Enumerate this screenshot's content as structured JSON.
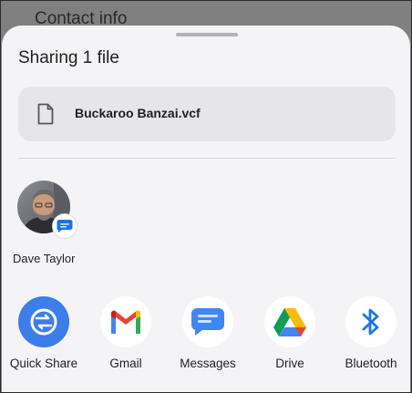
{
  "background": {
    "text": "Contact info"
  },
  "sheet": {
    "title": "Sharing 1 file",
    "file": {
      "name": "Buckaroo Banzai.vcf",
      "icon": "document-icon"
    }
  },
  "contacts": [
    {
      "name": "Dave Taylor",
      "badge_icon": "messages-icon"
    }
  ],
  "apps": [
    {
      "label": "Quick Share",
      "icon": "quick-share-icon",
      "color": "#3b7de9"
    },
    {
      "label": "Gmail",
      "icon": "gmail-icon"
    },
    {
      "label": "Messages",
      "icon": "messages-icon",
      "color": "#4285f4"
    },
    {
      "label": "Drive",
      "icon": "google-drive-icon"
    },
    {
      "label": "Bluetooth",
      "icon": "bluetooth-icon",
      "color": "#1a73e8"
    }
  ]
}
